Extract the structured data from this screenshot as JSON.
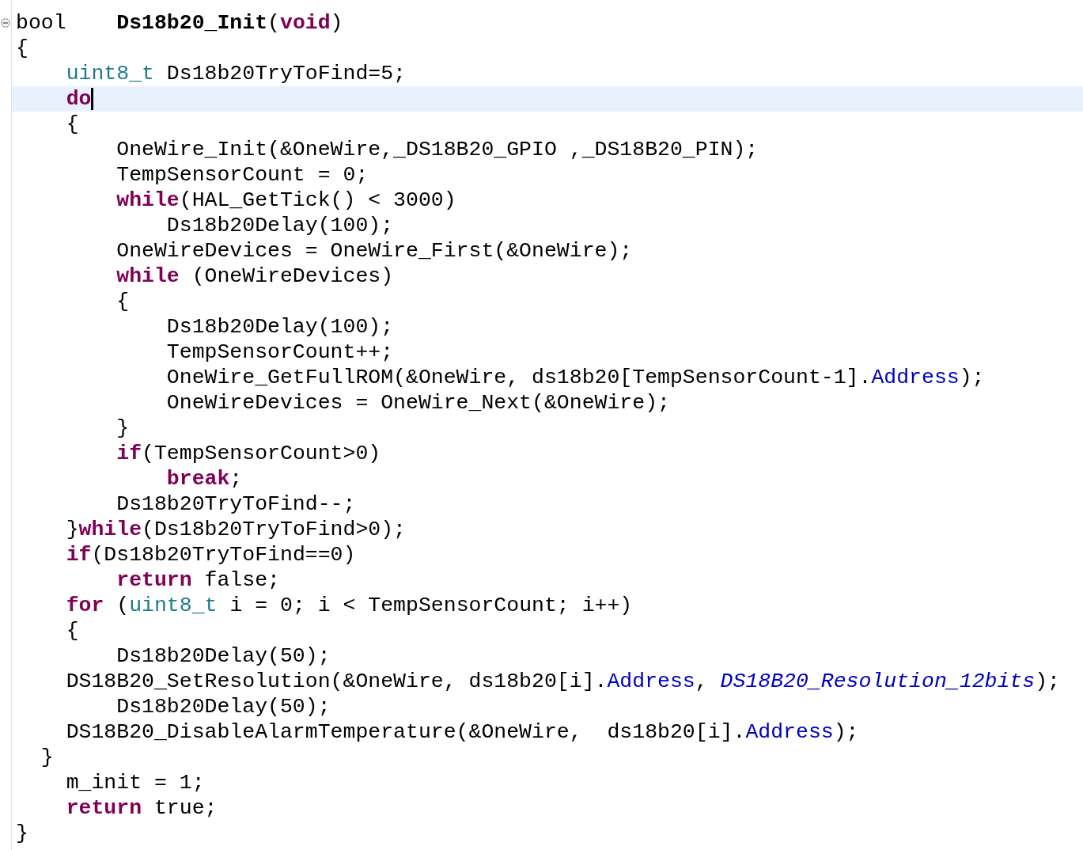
{
  "editor": {
    "lines": [
      {
        "tokens": [
          {
            "text": "bool\t",
            "kind": "plain"
          },
          {
            "text": "Ds18b20_Init",
            "kind": "function"
          },
          {
            "text": "(",
            "kind": "plain"
          },
          {
            "text": "void",
            "kind": "keyword"
          },
          {
            "text": ")",
            "kind": "plain"
          }
        ],
        "fold": {
          "expanded": true
        },
        "current": false
      },
      {
        "tokens": [
          {
            "text": "{",
            "kind": "plain"
          }
        ],
        "current": false
      },
      {
        "tokens": [
          {
            "text": "\tuint8_t",
            "kind": "type"
          },
          {
            "text": " Ds18b20TryToFind=5;",
            "kind": "plain"
          }
        ],
        "current": false
      },
      {
        "tokens": [
          {
            "text": "\tdo",
            "kind": "keyword"
          }
        ],
        "current": true
      },
      {
        "tokens": [
          {
            "text": "\t{",
            "kind": "plain"
          }
        ],
        "current": false
      },
      {
        "tokens": [
          {
            "text": "\t\tOneWire_Init(&OneWire,_DS18B20_GPIO ,_DS18B20_PIN);",
            "kind": "plain"
          }
        ],
        "current": false
      },
      {
        "tokens": [
          {
            "text": "\t\tTempSensorCount = 0;",
            "kind": "plain"
          }
        ],
        "current": false
      },
      {
        "tokens": [
          {
            "text": "\t\twhile",
            "kind": "keyword"
          },
          {
            "text": "(HAL_GetTick() < 3000)",
            "kind": "plain"
          }
        ],
        "current": false
      },
      {
        "tokens": [
          {
            "text": "\t\t\tDs18b20Delay(100);",
            "kind": "plain"
          }
        ],
        "current": false
      },
      {
        "tokens": [
          {
            "text": "\t\tOneWireDevices = OneWire_First(&OneWire);",
            "kind": "plain"
          }
        ],
        "current": false
      },
      {
        "tokens": [
          {
            "text": "\t\twhile",
            "kind": "keyword"
          },
          {
            "text": " (OneWireDevices)",
            "kind": "plain"
          }
        ],
        "current": false
      },
      {
        "tokens": [
          {
            "text": "\t\t{",
            "kind": "plain"
          }
        ],
        "current": false
      },
      {
        "tokens": [
          {
            "text": "\t\t\tDs18b20Delay(100);",
            "kind": "plain"
          }
        ],
        "current": false
      },
      {
        "tokens": [
          {
            "text": "\t\t\tTempSensorCount++;",
            "kind": "plain"
          }
        ],
        "current": false
      },
      {
        "tokens": [
          {
            "text": "\t\t\tOneWire_GetFullROM(&OneWire, ds18b20[TempSensorCount-1].",
            "kind": "plain"
          },
          {
            "text": "Address",
            "kind": "field"
          },
          {
            "text": ");",
            "kind": "plain"
          }
        ],
        "current": false
      },
      {
        "tokens": [
          {
            "text": "\t\t\tOneWireDevices = OneWire_Next(&OneWire);",
            "kind": "plain"
          }
        ],
        "current": false
      },
      {
        "tokens": [
          {
            "text": "\t\t}",
            "kind": "plain"
          }
        ],
        "current": false
      },
      {
        "tokens": [
          {
            "text": "\t\tif",
            "kind": "keyword"
          },
          {
            "text": "(TempSensorCount>0)",
            "kind": "plain"
          }
        ],
        "current": false
      },
      {
        "tokens": [
          {
            "text": "\t\t\tbreak",
            "kind": "keyword"
          },
          {
            "text": ";",
            "kind": "plain"
          }
        ],
        "current": false
      },
      {
        "tokens": [
          {
            "text": "\t\tDs18b20TryToFind--;",
            "kind": "plain"
          }
        ],
        "current": false
      },
      {
        "tokens": [
          {
            "text": "\t}",
            "kind": "plain"
          },
          {
            "text": "while",
            "kind": "keyword"
          },
          {
            "text": "(Ds18b20TryToFind>0);",
            "kind": "plain"
          }
        ],
        "current": false
      },
      {
        "tokens": [
          {
            "text": "\tif",
            "kind": "keyword"
          },
          {
            "text": "(Ds18b20TryToFind==0)",
            "kind": "plain"
          }
        ],
        "current": false
      },
      {
        "tokens": [
          {
            "text": "\t\treturn",
            "kind": "keyword"
          },
          {
            "text": " false;",
            "kind": "plain"
          }
        ],
        "current": false
      },
      {
        "tokens": [
          {
            "text": "\tfor",
            "kind": "keyword"
          },
          {
            "text": " (",
            "kind": "plain"
          },
          {
            "text": "uint8_t",
            "kind": "type"
          },
          {
            "text": " i = 0; i < TempSensorCount; i++)",
            "kind": "plain"
          }
        ],
        "current": false
      },
      {
        "tokens": [
          {
            "text": "\t{",
            "kind": "plain"
          }
        ],
        "current": false
      },
      {
        "tokens": [
          {
            "text": "\t\tDs18b20Delay(50);",
            "kind": "plain"
          }
        ],
        "current": false
      },
      {
        "tokens": [
          {
            "text": "\tDS18B20_SetResolution(&OneWire, ds18b20[i].",
            "kind": "plain"
          },
          {
            "text": "Address",
            "kind": "field"
          },
          {
            "text": ", ",
            "kind": "plain"
          },
          {
            "text": "DS18B20_Resolution_12bits",
            "kind": "enum"
          },
          {
            "text": ");",
            "kind": "plain"
          }
        ],
        "current": false
      },
      {
        "tokens": [
          {
            "text": "\t\tDs18b20Delay(50);",
            "kind": "plain"
          }
        ],
        "current": false
      },
      {
        "tokens": [
          {
            "text": "\tDS18B20_DisableAlarmTemperature(&OneWire,  ds18b20[i].",
            "kind": "plain"
          },
          {
            "text": "Address",
            "kind": "field"
          },
          {
            "text": ");",
            "kind": "plain"
          }
        ],
        "current": false
      },
      {
        "tokens": [
          {
            "text": "  }",
            "kind": "plain"
          }
        ],
        "current": false
      },
      {
        "tokens": [
          {
            "text": "\tm_init = 1;",
            "kind": "plain"
          }
        ],
        "current": false
      },
      {
        "tokens": [
          {
            "text": "\treturn",
            "kind": "keyword"
          },
          {
            "text": " true;",
            "kind": "plain"
          }
        ],
        "current": false
      },
      {
        "tokens": [
          {
            "text": "}",
            "kind": "plain"
          }
        ],
        "current": false
      }
    ]
  }
}
